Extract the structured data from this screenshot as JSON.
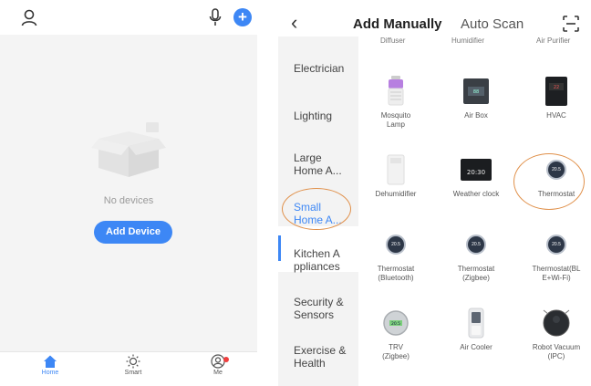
{
  "left": {
    "empty_text": "No devices",
    "add_device": "Add Device",
    "tabs": [
      {
        "label": "Home",
        "icon": "home-icon"
      },
      {
        "label": "Smart",
        "icon": "sun-icon"
      },
      {
        "label": "Me",
        "icon": "profile-icon"
      }
    ],
    "accent": "#3d87f5"
  },
  "right": {
    "tabs": [
      "Add Manually",
      "Auto Scan"
    ],
    "sidebar": [
      "Electrician",
      "Lighting",
      "Large\nHome A...",
      "Small\nHome A...",
      "Kitchen A\nppliances",
      "Security &\nSensors",
      "Exercise &\nHealth"
    ],
    "cut_labels": [
      "Diffuser",
      "Humidifier",
      "Air Purifier"
    ],
    "devices": [
      {
        "label": "Mosquito\nLamp",
        "icon": "mosquito-lamp-icon"
      },
      {
        "label": "Air Box",
        "icon": "air-box-icon"
      },
      {
        "label": "HVAC",
        "icon": "hvac-icon"
      },
      {
        "label": "Dehumidifier",
        "icon": "dehumidifier-icon"
      },
      {
        "label": "Weather clock",
        "icon": "weather-clock-icon",
        "display": "20:30"
      },
      {
        "label": "Thermostat",
        "icon": "thermostat-icon",
        "display": "20.5"
      },
      {
        "label": "Thermostat\n(Bluetooth)",
        "icon": "thermostat-icon",
        "display": "20.5"
      },
      {
        "label": "Thermostat\n(Zigbee)",
        "icon": "thermostat-icon",
        "display": "20.5"
      },
      {
        "label": "Thermostat(BL\nE+Wi-Fi)",
        "icon": "thermostat-icon",
        "display": "20.5"
      },
      {
        "label": "TRV\n(Zigbee)",
        "icon": "trv-icon",
        "display": "20.5"
      },
      {
        "label": "Air Cooler",
        "icon": "air-cooler-icon"
      },
      {
        "label": "Robot Vacuum\n(IPC)",
        "icon": "robot-vacuum-icon"
      }
    ],
    "accent": "#3d87f5",
    "highlight": "#e0904a"
  }
}
